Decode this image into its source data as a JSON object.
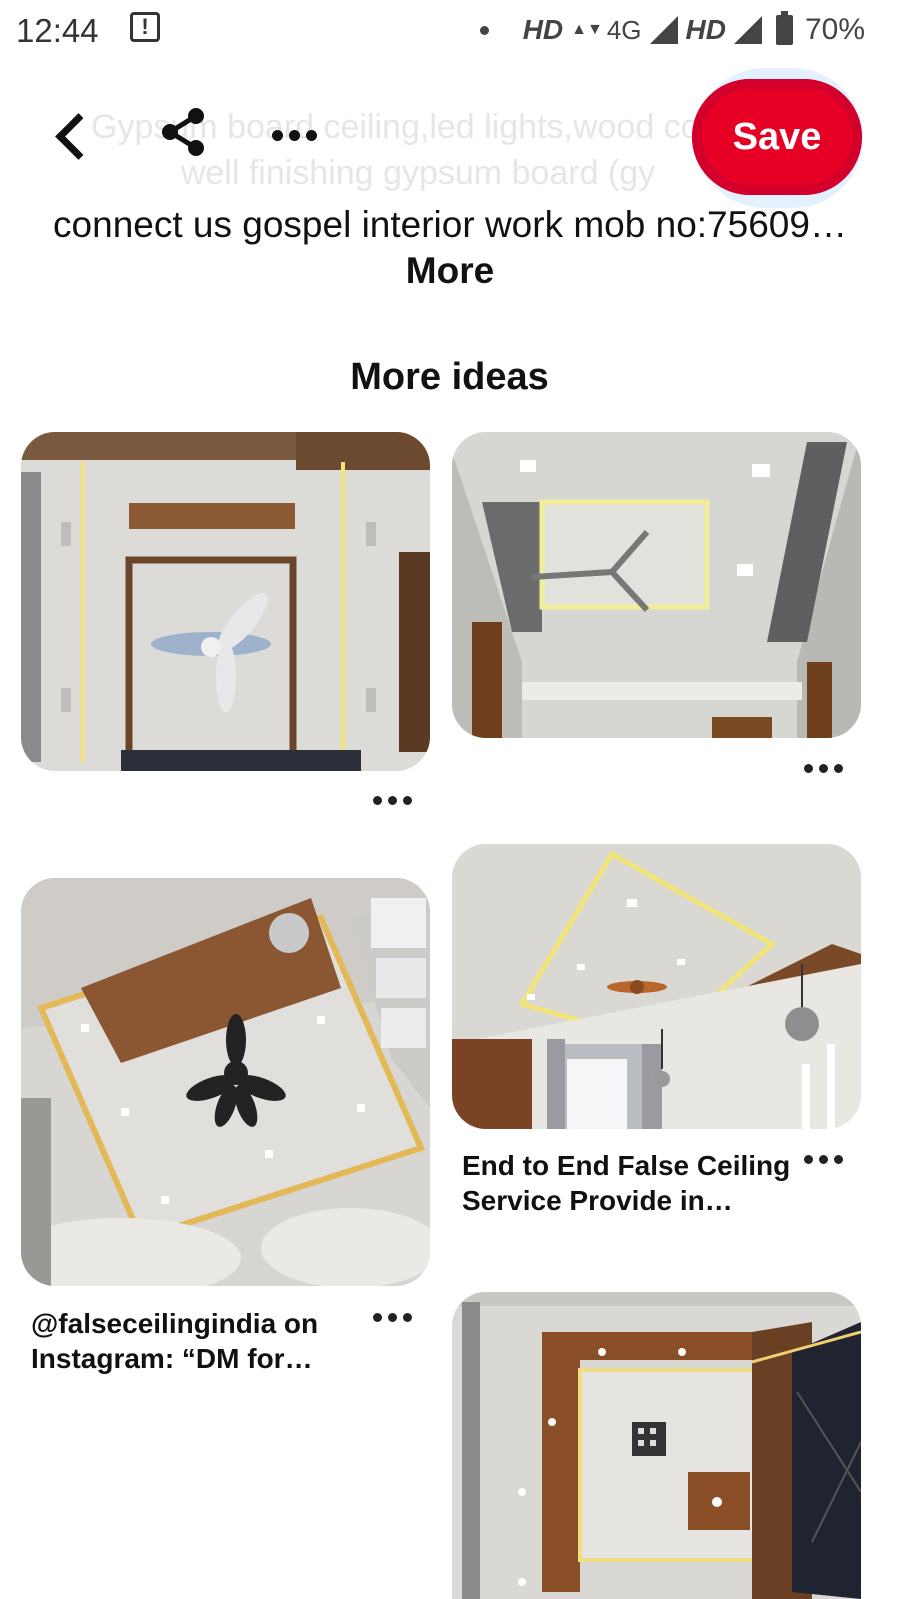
{
  "status_bar": {
    "time": "12:44",
    "alert_icon": "!",
    "network_1": "HD",
    "network_type": "4G",
    "network_2": "HD",
    "battery": "70%"
  },
  "header": {
    "save_label": "Save",
    "ghost_description": "Gypsum board ceiling,led lights,wood color, well finishing gypsum board (gy",
    "description": "connect us gospel interior work mob no:75609…",
    "description_more": "More"
  },
  "section": {
    "title": "More ideas"
  },
  "pins": [
    {
      "title": ""
    },
    {
      "title": ""
    },
    {
      "title": "@falseceilingindia on Instagram: “DM for…"
    },
    {
      "title": "End to End False Ceiling Service Provide in…"
    },
    {
      "title": ""
    }
  ]
}
